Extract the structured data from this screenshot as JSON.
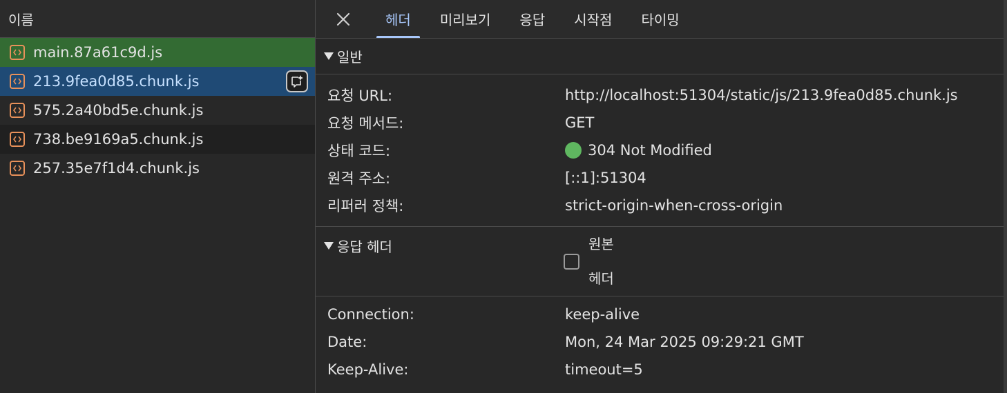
{
  "request_list": {
    "header": "이름",
    "items": [
      {
        "name": "main.87a61c9d.js",
        "state": "green"
      },
      {
        "name": "213.9fea0d85.chunk.js",
        "state": "selected"
      },
      {
        "name": "575.2a40bd5e.chunk.js",
        "state": "normal"
      },
      {
        "name": "738.be9169a5.chunk.js",
        "state": "alt"
      },
      {
        "name": "257.35e7f1d4.chunk.js",
        "state": "normal"
      }
    ]
  },
  "tabs": [
    "헤더",
    "미리보기",
    "응답",
    "시작점",
    "타이밍"
  ],
  "active_tab": "헤더",
  "general": {
    "title": "일반",
    "rows": [
      {
        "key": "요청 URL:",
        "value": "http://localhost:51304/static/js/213.9fea0d85.chunk.js"
      },
      {
        "key": "요청 메서드:",
        "value": "GET"
      },
      {
        "key": "상태 코드:",
        "value": "304 Not Modified"
      },
      {
        "key": "원격 주소:",
        "value": "[::1]:51304"
      },
      {
        "key": "리퍼러 정책:",
        "value": "strict-origin-when-cross-origin"
      }
    ]
  },
  "response_headers": {
    "title": "응답 헤더",
    "raw_toggle_line1": "원본",
    "raw_toggle_line2": "헤더",
    "raw_checked": false,
    "rows": [
      {
        "key": "Connection:",
        "value": "keep-alive"
      },
      {
        "key": "Date:",
        "value": "Mon, 24 Mar 2025 09:29:21 GMT"
      },
      {
        "key": "Keep-Alive:",
        "value": "timeout=5"
      }
    ]
  },
  "colors": {
    "status_ok": "#5fb760",
    "selected_row": "#1f4a75",
    "green_row": "#336b33",
    "accent": "#a8c7fa",
    "file_icon": "#e8915a"
  },
  "icons": {
    "file": "js-file-icon",
    "close": "close-icon",
    "ai": "ai-assist-icon"
  }
}
